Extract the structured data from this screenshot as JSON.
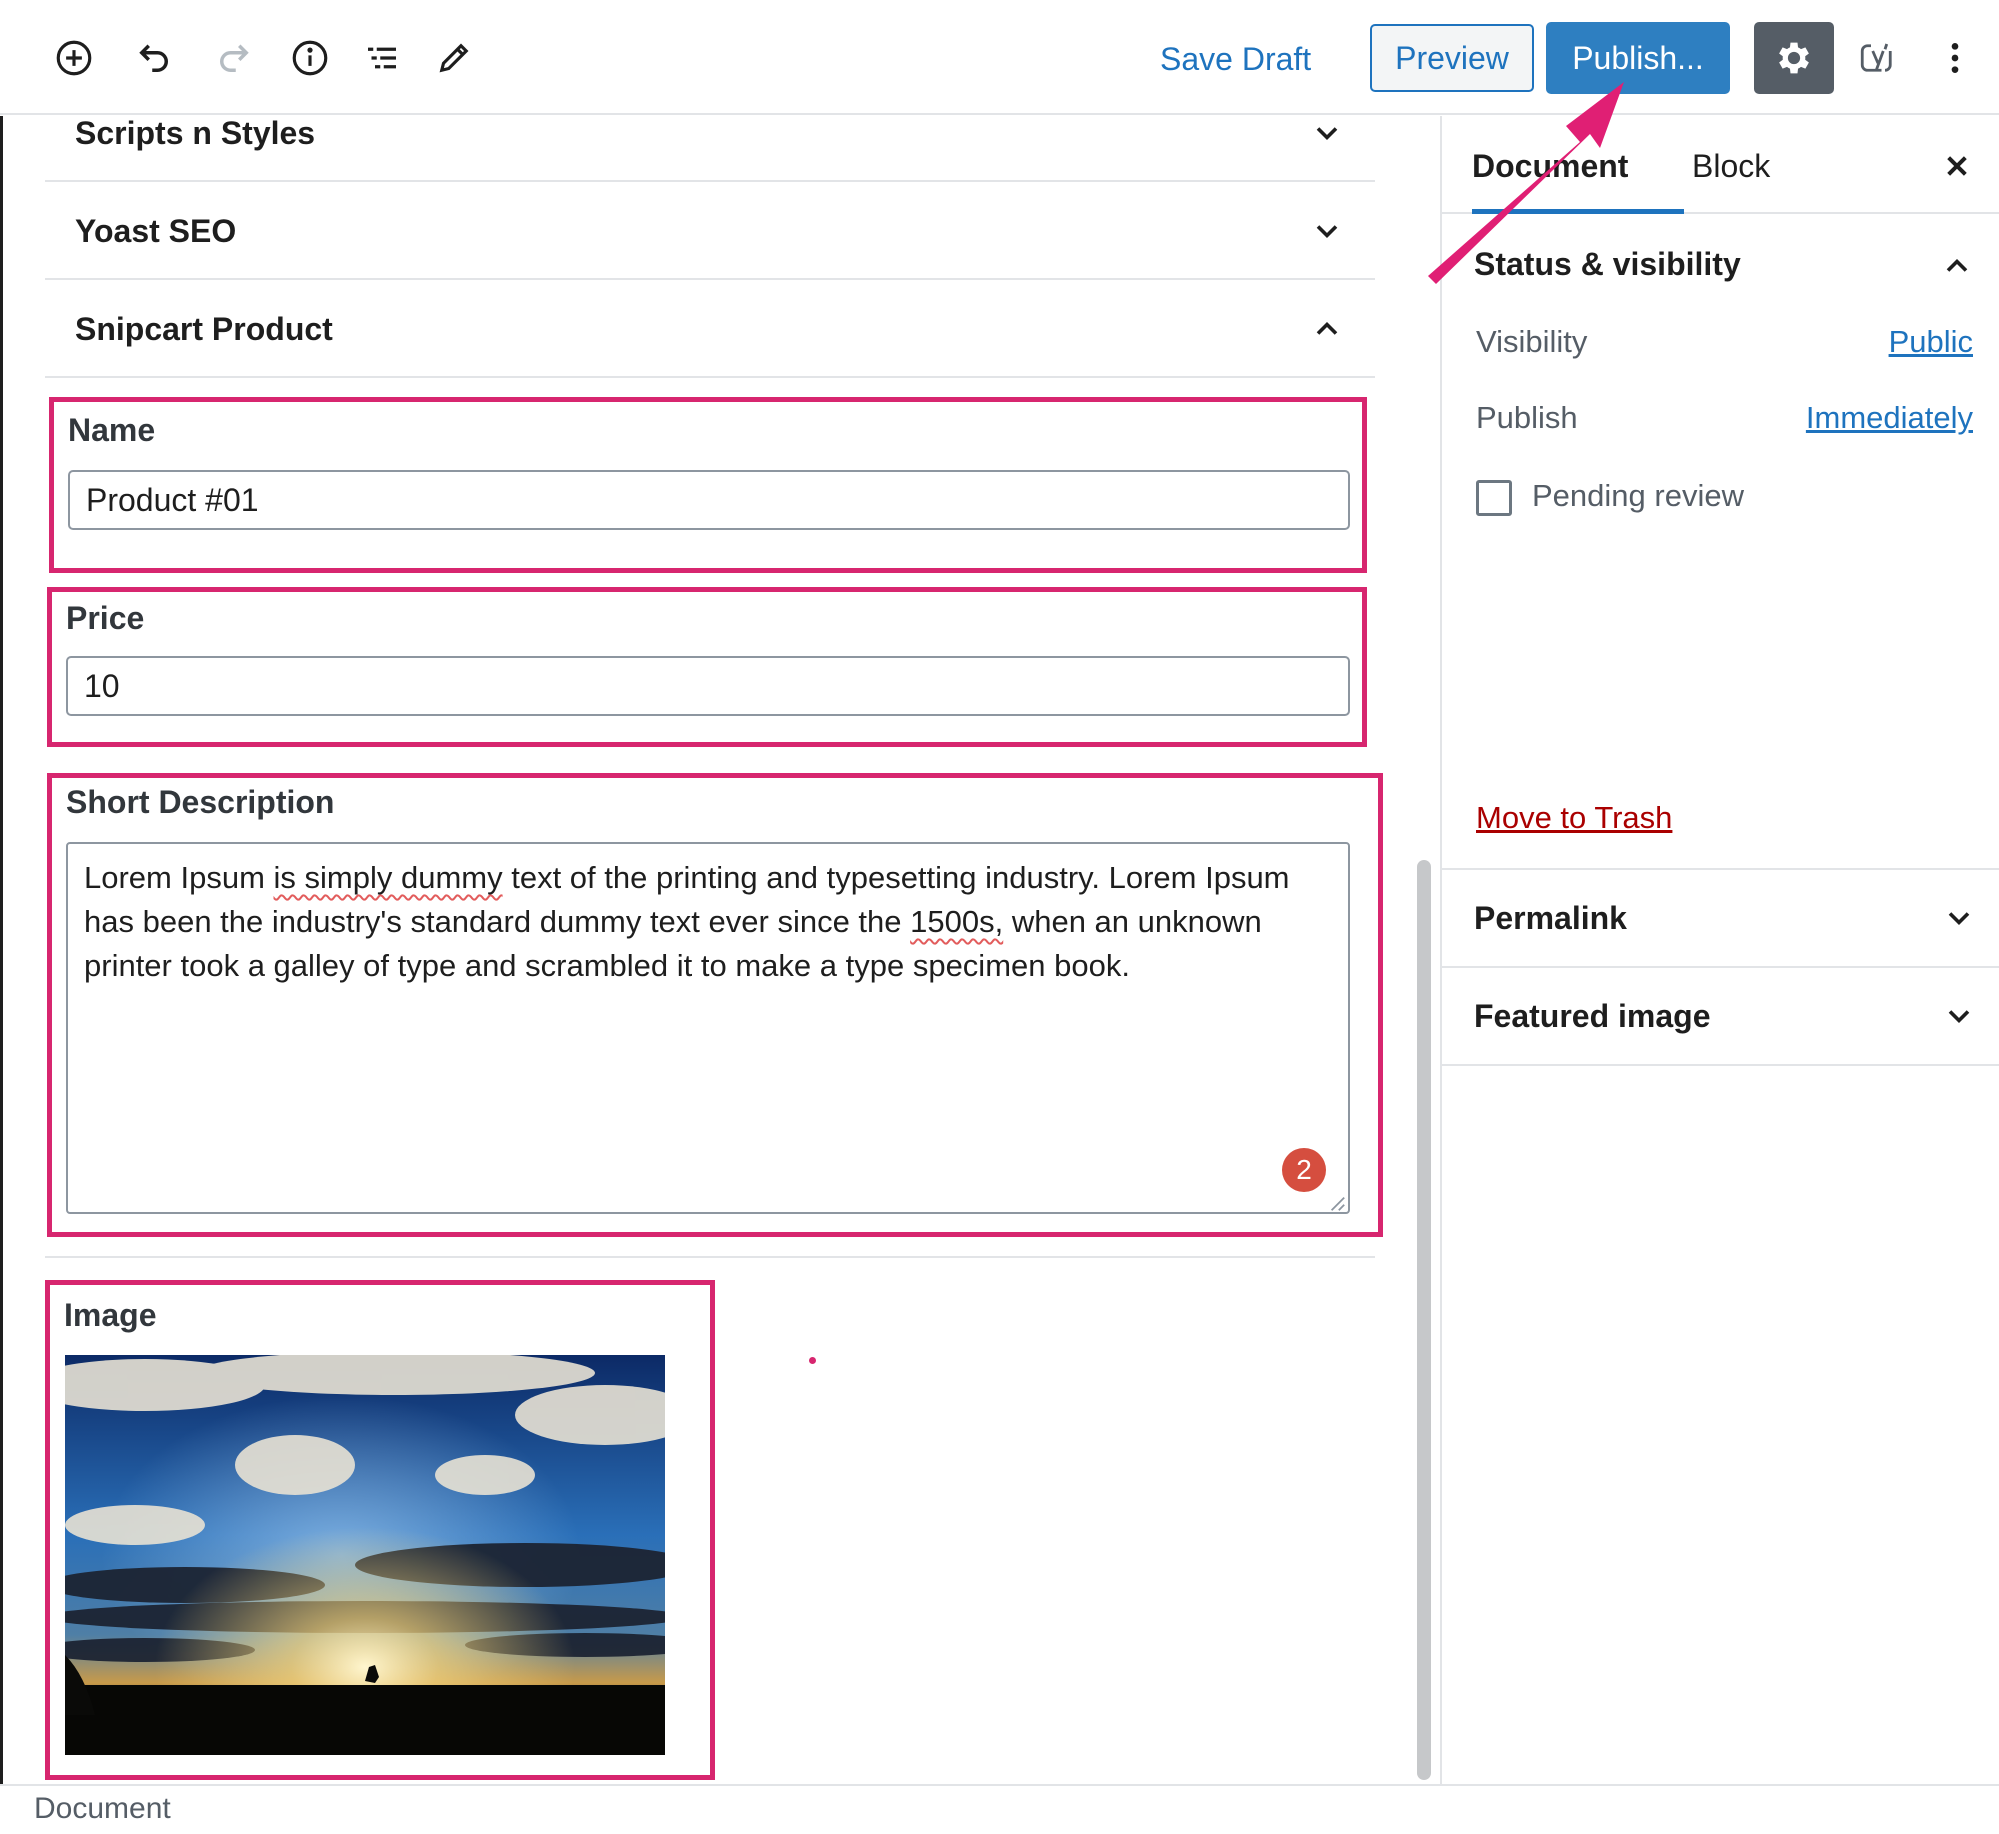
{
  "toolbar": {
    "icons": [
      "add-block-icon",
      "undo-icon",
      "redo-icon",
      "info-icon",
      "outline-icon",
      "pencil-icon"
    ],
    "save_draft": "Save Draft",
    "preview": "Preview",
    "publish": "Publish...",
    "settings_icon": "gear-icon",
    "yoast_icon": "yoast-icon",
    "more_icon": "kebab-menu-icon"
  },
  "editor": {
    "panels": [
      {
        "title": "Scripts n Styles",
        "expanded": false
      },
      {
        "title": "Yoast SEO",
        "expanded": false
      },
      {
        "title": "Snipcart Product",
        "expanded": true
      }
    ],
    "fields": {
      "name_label": "Name",
      "name_value": "Product #01",
      "price_label": "Price",
      "price_value": "10",
      "description_label": "Short Description",
      "description_parts": {
        "p1": "Lorem Ipsum ",
        "p2": "is simply dummy",
        "p3": " text of the printing and typesetting industry. Lorem Ipsum has been the industry's standard dummy text ever since the ",
        "p4": "1500s,",
        "p5": " when an unknown printer took a galley of type and scrambled it to make a type specimen book."
      },
      "grammar_badge": "2",
      "image_label": "Image"
    }
  },
  "sidebar": {
    "tabs": [
      "Document",
      "Block"
    ],
    "active_tab": "Document",
    "status_title": "Status & visibility",
    "visibility_label": "Visibility",
    "visibility_value": "Public",
    "publish_label": "Publish",
    "publish_value": "Immediately",
    "pending_review": "Pending review",
    "move_to_trash": "Move to Trash",
    "permalink": "Permalink",
    "featured_image": "Featured image"
  },
  "footer": {
    "breadcrumb": "Document"
  },
  "colors": {
    "accent": "#1e73be",
    "publish_bg": "#2e7fc1",
    "highlight": "#d7266f",
    "trash": "#aa0000",
    "badge": "#d54e3f"
  }
}
